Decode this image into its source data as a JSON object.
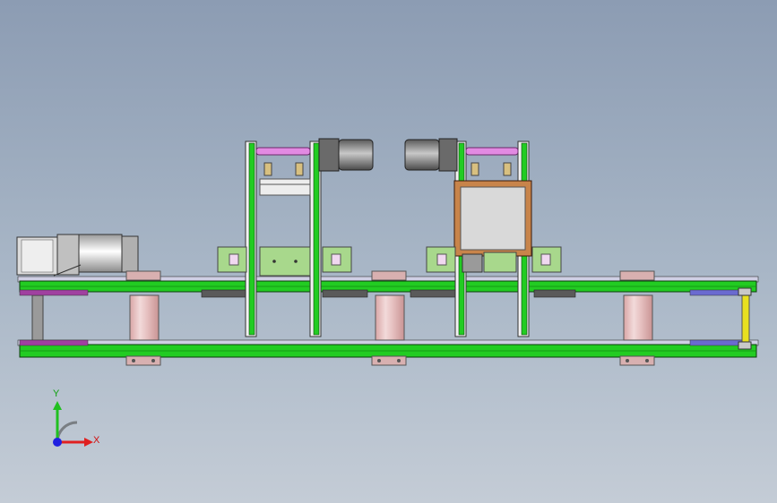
{
  "viewport": {
    "background_top": "#8c9cb3",
    "background_bottom": "#c4ccd6"
  },
  "model": {
    "colors": {
      "rail_green": "#22cc22",
      "rail_edge": "#0b3d0b",
      "pillar_pink": "#e8c4c4",
      "motor_grey": "#8a8a8a",
      "shaft_violet": "#e28ae2",
      "bracket_brown": "#c8844a",
      "block_green": "#a8d88c",
      "end_yellow": "#e8e020"
    }
  },
  "triad": {
    "x_label": "X",
    "y_label": "Y",
    "x_color": "#e02020",
    "y_color": "#20c020",
    "z_color": "#2020e0"
  }
}
